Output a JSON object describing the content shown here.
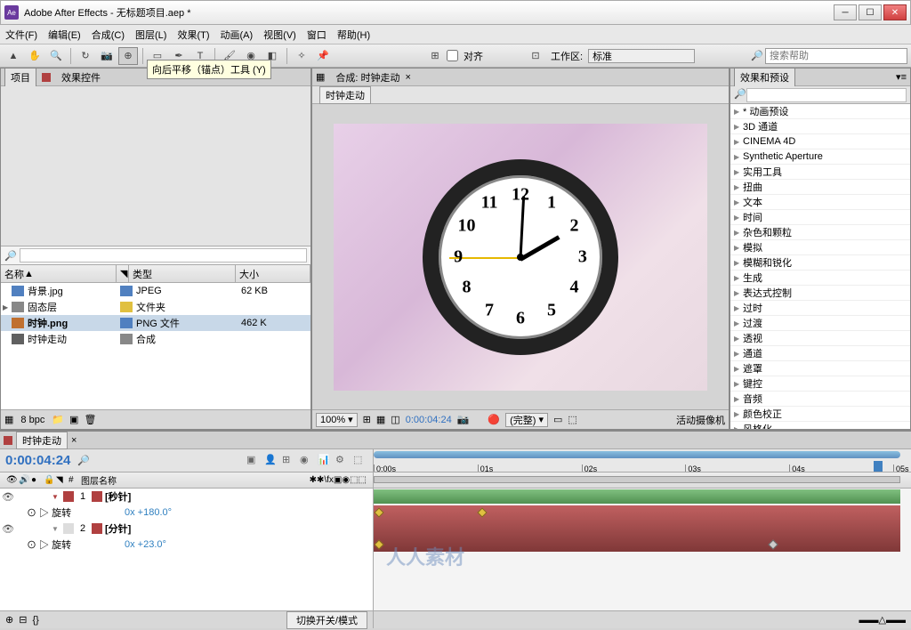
{
  "titlebar": {
    "app": "Adobe After Effects - 无标题项目.aep *"
  },
  "menu": [
    "文件(F)",
    "编辑(E)",
    "合成(C)",
    "图层(L)",
    "效果(T)",
    "动画(A)",
    "视图(V)",
    "窗口",
    "帮助(H)"
  ],
  "toolbar": {
    "tooltip": "向后平移（锚点）工具 (Y)",
    "snap": "对齐",
    "workarea_label": "工作区:",
    "workarea_value": "标准",
    "search_placeholder": "搜索帮助"
  },
  "project": {
    "tabs": [
      "项目",
      "效果控件"
    ],
    "cols": {
      "name": "名称",
      "type": "类型",
      "size": "大小"
    },
    "items": [
      {
        "name": "背景.jpg",
        "type": "JPEG",
        "size": "62 KB",
        "ic": "#5080c0",
        "tc": "#5080c0"
      },
      {
        "name": "固态层",
        "type": "文件夹",
        "size": "",
        "ic": "#888",
        "tc": "#e0c040"
      },
      {
        "name": "时钟.png",
        "type": "PNG 文件",
        "size": "462 K",
        "ic": "#c07030",
        "tc": "#5080c0",
        "sel": true
      },
      {
        "name": "时钟走动",
        "type": "合成",
        "size": "",
        "ic": "#606060",
        "tc": "#888"
      }
    ],
    "bpc": "8 bpc"
  },
  "comp": {
    "label": "合成: 时钟走动",
    "name": "时钟走动",
    "zoom": "100%",
    "time": "0:00:04:24",
    "quality": "(完整)",
    "camera": "活动摄像机"
  },
  "clock_numbers": [
    "12",
    "1",
    "2",
    "3",
    "4",
    "5",
    "6",
    "7",
    "8",
    "9",
    "10",
    "11"
  ],
  "effects": {
    "title": "效果和预设",
    "items": [
      "* 动画预设",
      "3D 通道",
      "CINEMA 4D",
      "Synthetic Aperture",
      "实用工具",
      "扭曲",
      "文本",
      "时间",
      "杂色和颗粒",
      "模拟",
      "模糊和锐化",
      "生成",
      "表达式控制",
      "过时",
      "过渡",
      "透视",
      "通道",
      "遮罩",
      "键控",
      "音频",
      "颜色校正",
      "风格化"
    ]
  },
  "timeline": {
    "comp": "时钟走动",
    "time": "0:00:04:24",
    "colhead": "图层名称",
    "ticks": [
      "0:00s",
      "01s",
      "02s",
      "03s",
      "04s",
      "05s"
    ],
    "layers": [
      {
        "num": "1",
        "name": "[秒针]",
        "color": "#b04040"
      },
      {
        "num": "2",
        "name": "[分针]",
        "color": "#b04040"
      }
    ],
    "props": [
      {
        "name": "旋转",
        "value": "0x +180.0°"
      },
      {
        "name": "旋转",
        "value": "0x +23.0°"
      }
    ],
    "switch_btn": "切换开关/模式"
  }
}
